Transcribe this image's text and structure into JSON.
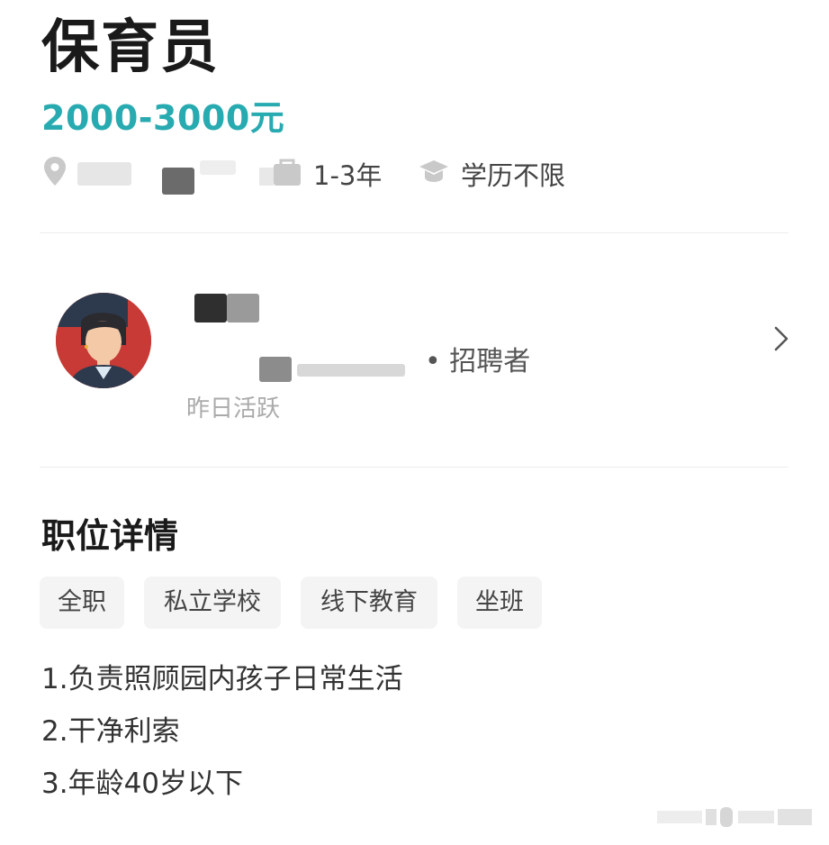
{
  "job": {
    "title": "保育员",
    "salary": "2000-3000元",
    "experience": "1-3年",
    "education": "学历不限"
  },
  "meta_icons": {
    "location": "location-pin-icon",
    "experience": "briefcase-icon",
    "education": "graduation-cap-icon"
  },
  "recruiter": {
    "role_suffix": "• 招聘者",
    "active_status": "昨日活跃"
  },
  "details": {
    "section_title": "职位详情",
    "tags": [
      "全职",
      "私立学校",
      "线下教育",
      "坐班"
    ],
    "description": [
      "1.负责照顾园内孩子日常生活",
      "2.干净利索",
      "3.年龄40岁以下"
    ]
  },
  "colors": {
    "salary": "#27aab0",
    "tag_background": "#f4f4f4",
    "divider": "#ececec"
  }
}
